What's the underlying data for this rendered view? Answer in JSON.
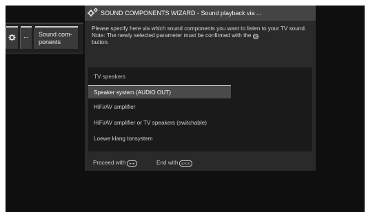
{
  "menu": {
    "gear_icon": "gear-icon",
    "dots": "...",
    "label": "Sound com- ponents"
  },
  "wizard": {
    "title_icon": "gears-icon",
    "title": "SOUND COMPONENTS WIZARD - Sound playback via ...",
    "description_1": "Please specify here via which sound components you want to listen to your TV sound.",
    "description_2a": "Note: The newly selected parameter must be confirmed with the",
    "ok_symbol": "OK",
    "description_2b": "button.",
    "options_header": "TV speakers",
    "options": [
      "Speaker system (AUDIO OUT)",
      "HiFi/AV amplifier",
      "HiFi/AV amplifier or TV speakers (switchable)",
      "Loewe klang tonsystem"
    ],
    "selected_index": 0,
    "footer": {
      "proceed_label": "Proceed with",
      "proceed_key": "►►",
      "end_label": "End with",
      "end_key": "BACK"
    }
  },
  "colors": {
    "screen_bg": "#0f0f0f",
    "panel_bg": "#2a2a2a",
    "title_bg": "#444444",
    "selected_bg": "#4a4a4a"
  }
}
